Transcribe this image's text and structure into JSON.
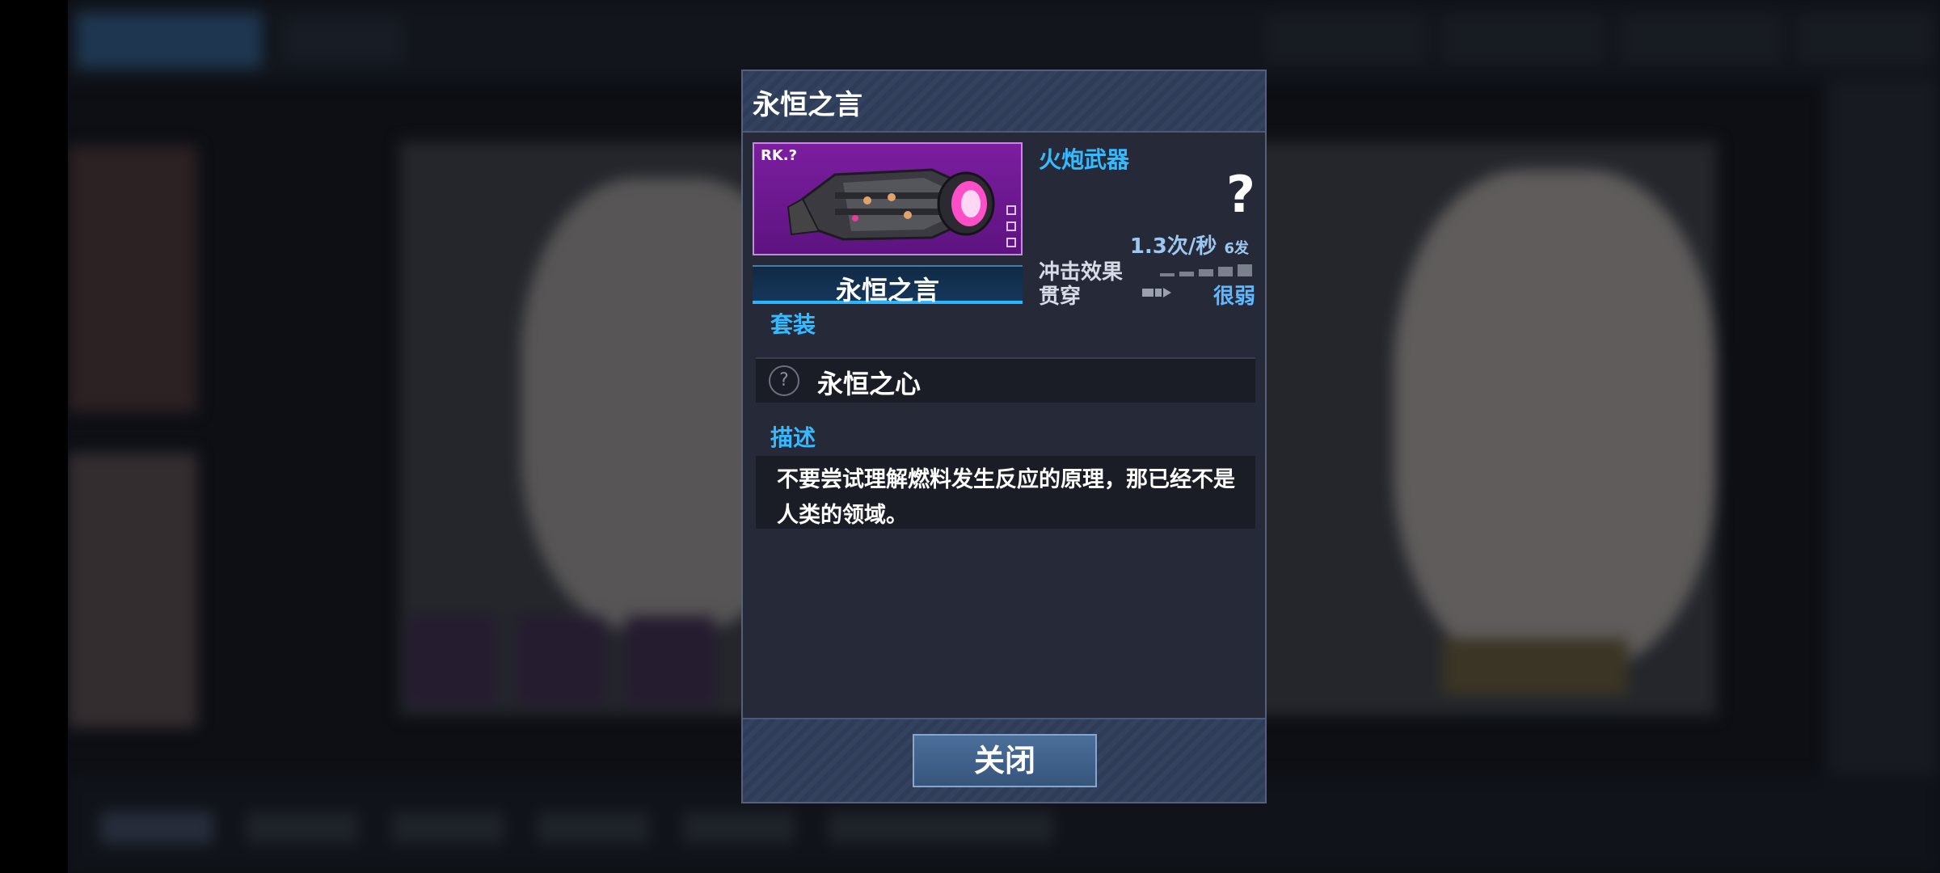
{
  "dialog": {
    "title": "永恒之言",
    "weapon": {
      "rank": "RK.?",
      "name": "永恒之言",
      "type": "火炮武器",
      "damage": "?",
      "fire_rate": "1.3次/秒",
      "magazine": "6发",
      "impact_label": "冲击效果",
      "pierce_label": "贯穿",
      "pierce_strength": "很弱",
      "art": "heavy-cannon-weapon-art"
    },
    "set": {
      "heading": "套装",
      "name": "永恒之心",
      "icon": "question-circle-icon"
    },
    "description": {
      "heading": "描述",
      "text": "不要尝试理解燃料发生反应的原理，那已经不是人类的领域。"
    },
    "close_label": "关闭"
  },
  "colors": {
    "accent_blue": "#35b9ff",
    "rarity_purple": "#7b1ea0",
    "panel": "#262a38"
  }
}
